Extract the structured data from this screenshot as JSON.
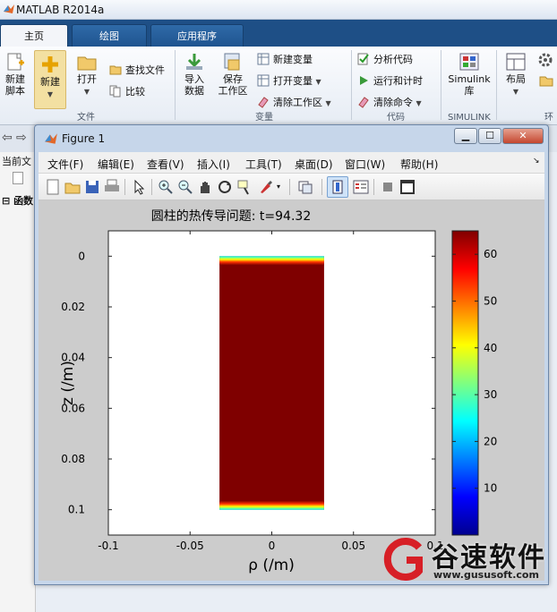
{
  "app": {
    "title": "MATLAB R2014a"
  },
  "tabs": [
    {
      "label": "主页"
    },
    {
      "label": "绘图"
    },
    {
      "label": "应用程序"
    }
  ],
  "ribbon": {
    "new_script": "新建\n脚本",
    "new": "新建",
    "open": "打开",
    "find_files": "查找文件",
    "compare": "比较",
    "import": "导入\n数据",
    "save_ws": "保存\n工作区",
    "new_var": "新建变量",
    "open_var": "打开变量",
    "clear_ws": "清除工作区",
    "analyze": "分析代码",
    "run_time": "运行和计时",
    "clear_cmd": "清除命令",
    "simulink": "Simulink\n库",
    "layout": "布局",
    "groups": {
      "file": "文件",
      "variable": "变量",
      "code": "代码",
      "simulink": "SIMULINK",
      "env": "环"
    }
  },
  "left_panel": {
    "current_folder": "当前文",
    "func": "函数"
  },
  "figure": {
    "title": "Figure 1",
    "menu": [
      "文件(F)",
      "编辑(E)",
      "查看(V)",
      "插入(I)",
      "工具(T)",
      "桌面(D)",
      "窗口(W)",
      "帮助(H)"
    ],
    "toolbar_icons": [
      "new-figure-icon",
      "open-icon",
      "save-icon",
      "print-icon",
      "pointer-icon",
      "zoom-in-icon",
      "zoom-out-icon",
      "pan-icon",
      "rotate-icon",
      "data-cursor-icon",
      "brush-icon",
      "link-icon",
      "colorbar-icon",
      "legend-icon",
      "hide-tools-icon",
      "show-tools-icon"
    ]
  },
  "chart_data": {
    "type": "heatmap",
    "title": "圆柱的热传导问题: t=94.32",
    "xlabel": "ρ (/m)",
    "ylabel": "z (/m)",
    "xlim": [
      -0.1,
      0.1
    ],
    "ylim": [
      0.11,
      -0.01
    ],
    "x_ticks": [
      "-0.1",
      "-0.05",
      "0",
      "0.05",
      "0.1"
    ],
    "x_tick_values": [
      -0.1,
      -0.05,
      0,
      0.05,
      0.1
    ],
    "y_ticks": [
      "0",
      "0.02",
      "0.04",
      "0.06",
      "0.08",
      "0.1"
    ],
    "y_tick_values": [
      0,
      0.02,
      0.04,
      0.06,
      0.08,
      0.1
    ],
    "field": {
      "x_range": [
        -0.032,
        0.032
      ],
      "z_range": [
        0,
        0.1
      ],
      "interior_value": 64,
      "edge_value": 0
    },
    "colorbar": {
      "min": 0,
      "max": 65,
      "ticks": [
        10,
        20,
        30,
        40,
        50,
        60
      ],
      "labels": [
        "10",
        "20",
        "30",
        "40",
        "50",
        "60"
      ]
    }
  },
  "watermark": {
    "brand": "谷速软件",
    "url": "www.gususoft.com"
  },
  "colors": {
    "field_hot": "#7f0000",
    "ribbon_tab_bg": "#1e4f86"
  }
}
